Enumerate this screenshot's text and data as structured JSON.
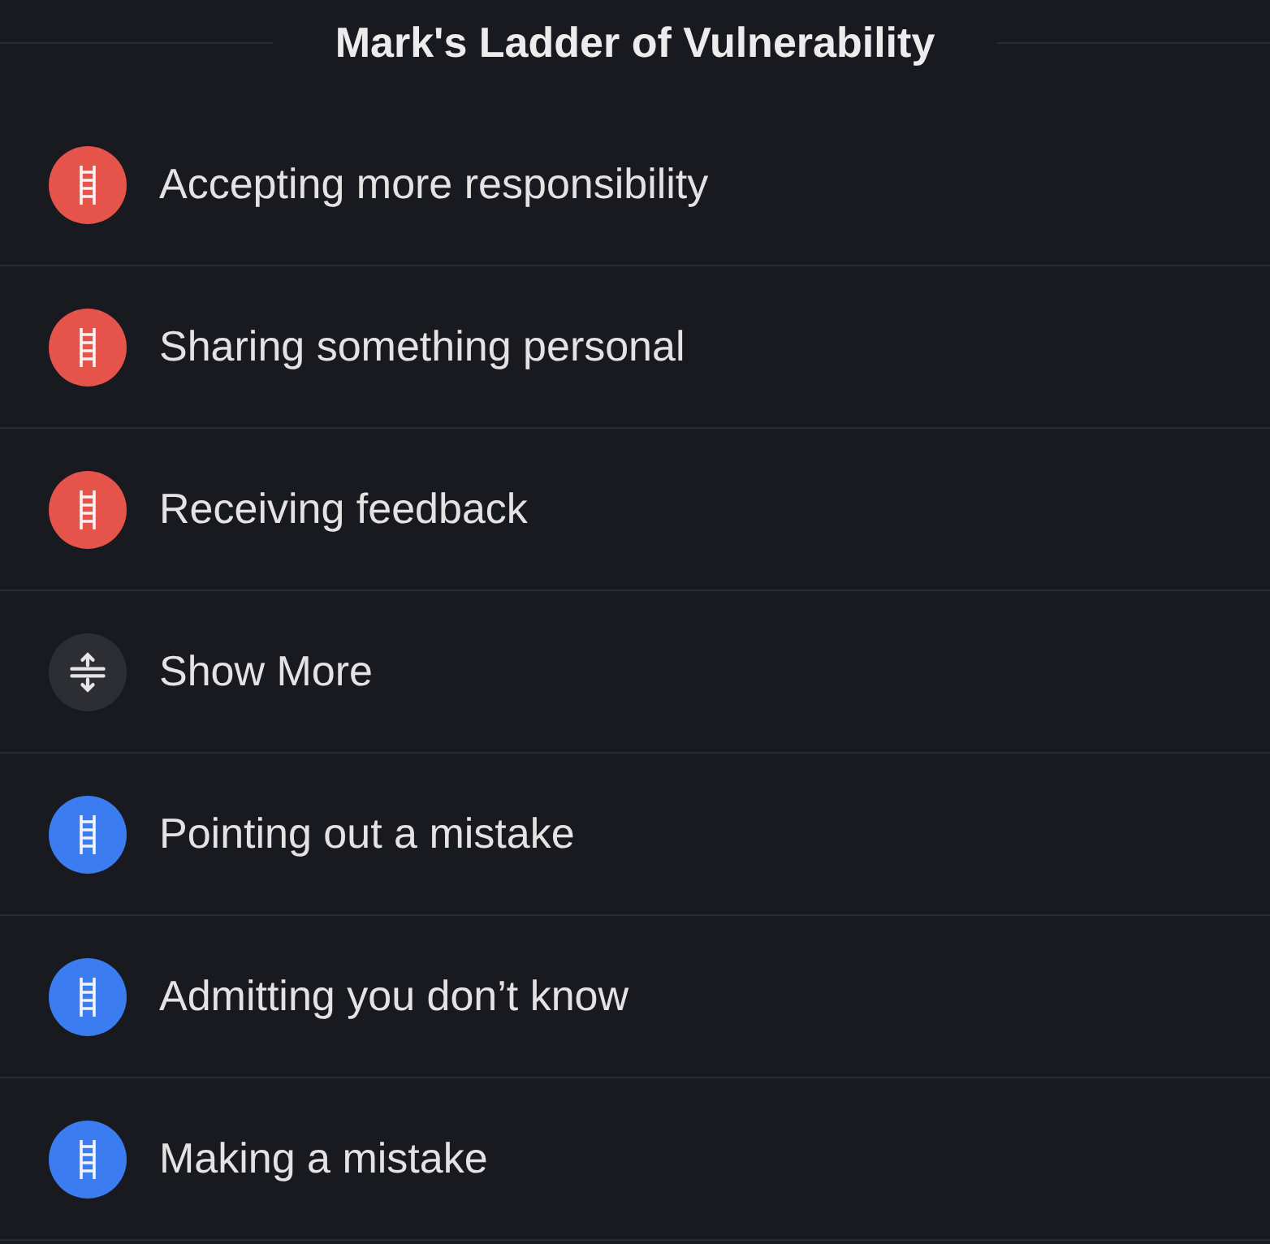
{
  "title": "Mark's Ladder of Vulnerability",
  "items": [
    {
      "kind": "step",
      "label": "Accepting more responsibility",
      "color": "#e5534b"
    },
    {
      "kind": "step",
      "label": "Sharing something personal",
      "color": "#e5534b"
    },
    {
      "kind": "step",
      "label": "Receiving feedback",
      "color": "#e5534b"
    },
    {
      "kind": "show_more",
      "label": "Show More"
    },
    {
      "kind": "step",
      "label": "Pointing out a mistake",
      "color": "#3b7cf0"
    },
    {
      "kind": "step",
      "label": "Admitting you don’t know",
      "color": "#3b7cf0"
    },
    {
      "kind": "step",
      "label": "Making a mistake",
      "color": "#3b7cf0"
    }
  ]
}
